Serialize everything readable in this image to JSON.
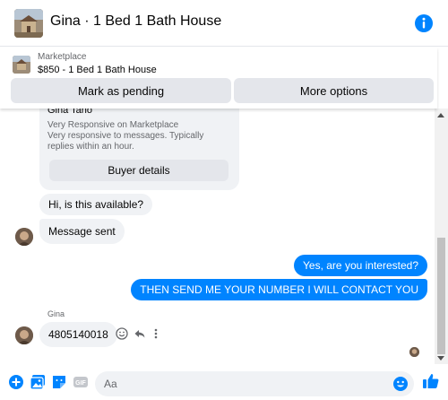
{
  "header": {
    "title": "Gina · 1 Bed 1 Bath House",
    "info_icon": "info-icon"
  },
  "marketplace": {
    "label": "Marketplace",
    "listing": "$850 - 1 Bed 1 Bath House",
    "buttons": {
      "mark_pending": "Mark as pending",
      "more_options": "More options"
    }
  },
  "seller_card": {
    "name": "Gina Tano",
    "line1": "Very Responsive on Marketplace",
    "line2": "Very responsive to messages. Typically replies within an hour.",
    "buyer_details": "Buyer details"
  },
  "messages": {
    "incoming1": "Hi, is this available?",
    "incoming2": "Message sent",
    "outgoing1": "Yes, are you interested?",
    "outgoing2": "THEN SEND ME YOUR NUMBER I WILL CONTACT YOU",
    "sender_name": "Gina",
    "incoming3": "4805140018"
  },
  "composer": {
    "placeholder": "Aa",
    "gif_label": "GIF"
  },
  "colors": {
    "accent": "#0084ff",
    "bubble_in": "#f0f2f5",
    "button_bg": "#e4e6eb"
  }
}
